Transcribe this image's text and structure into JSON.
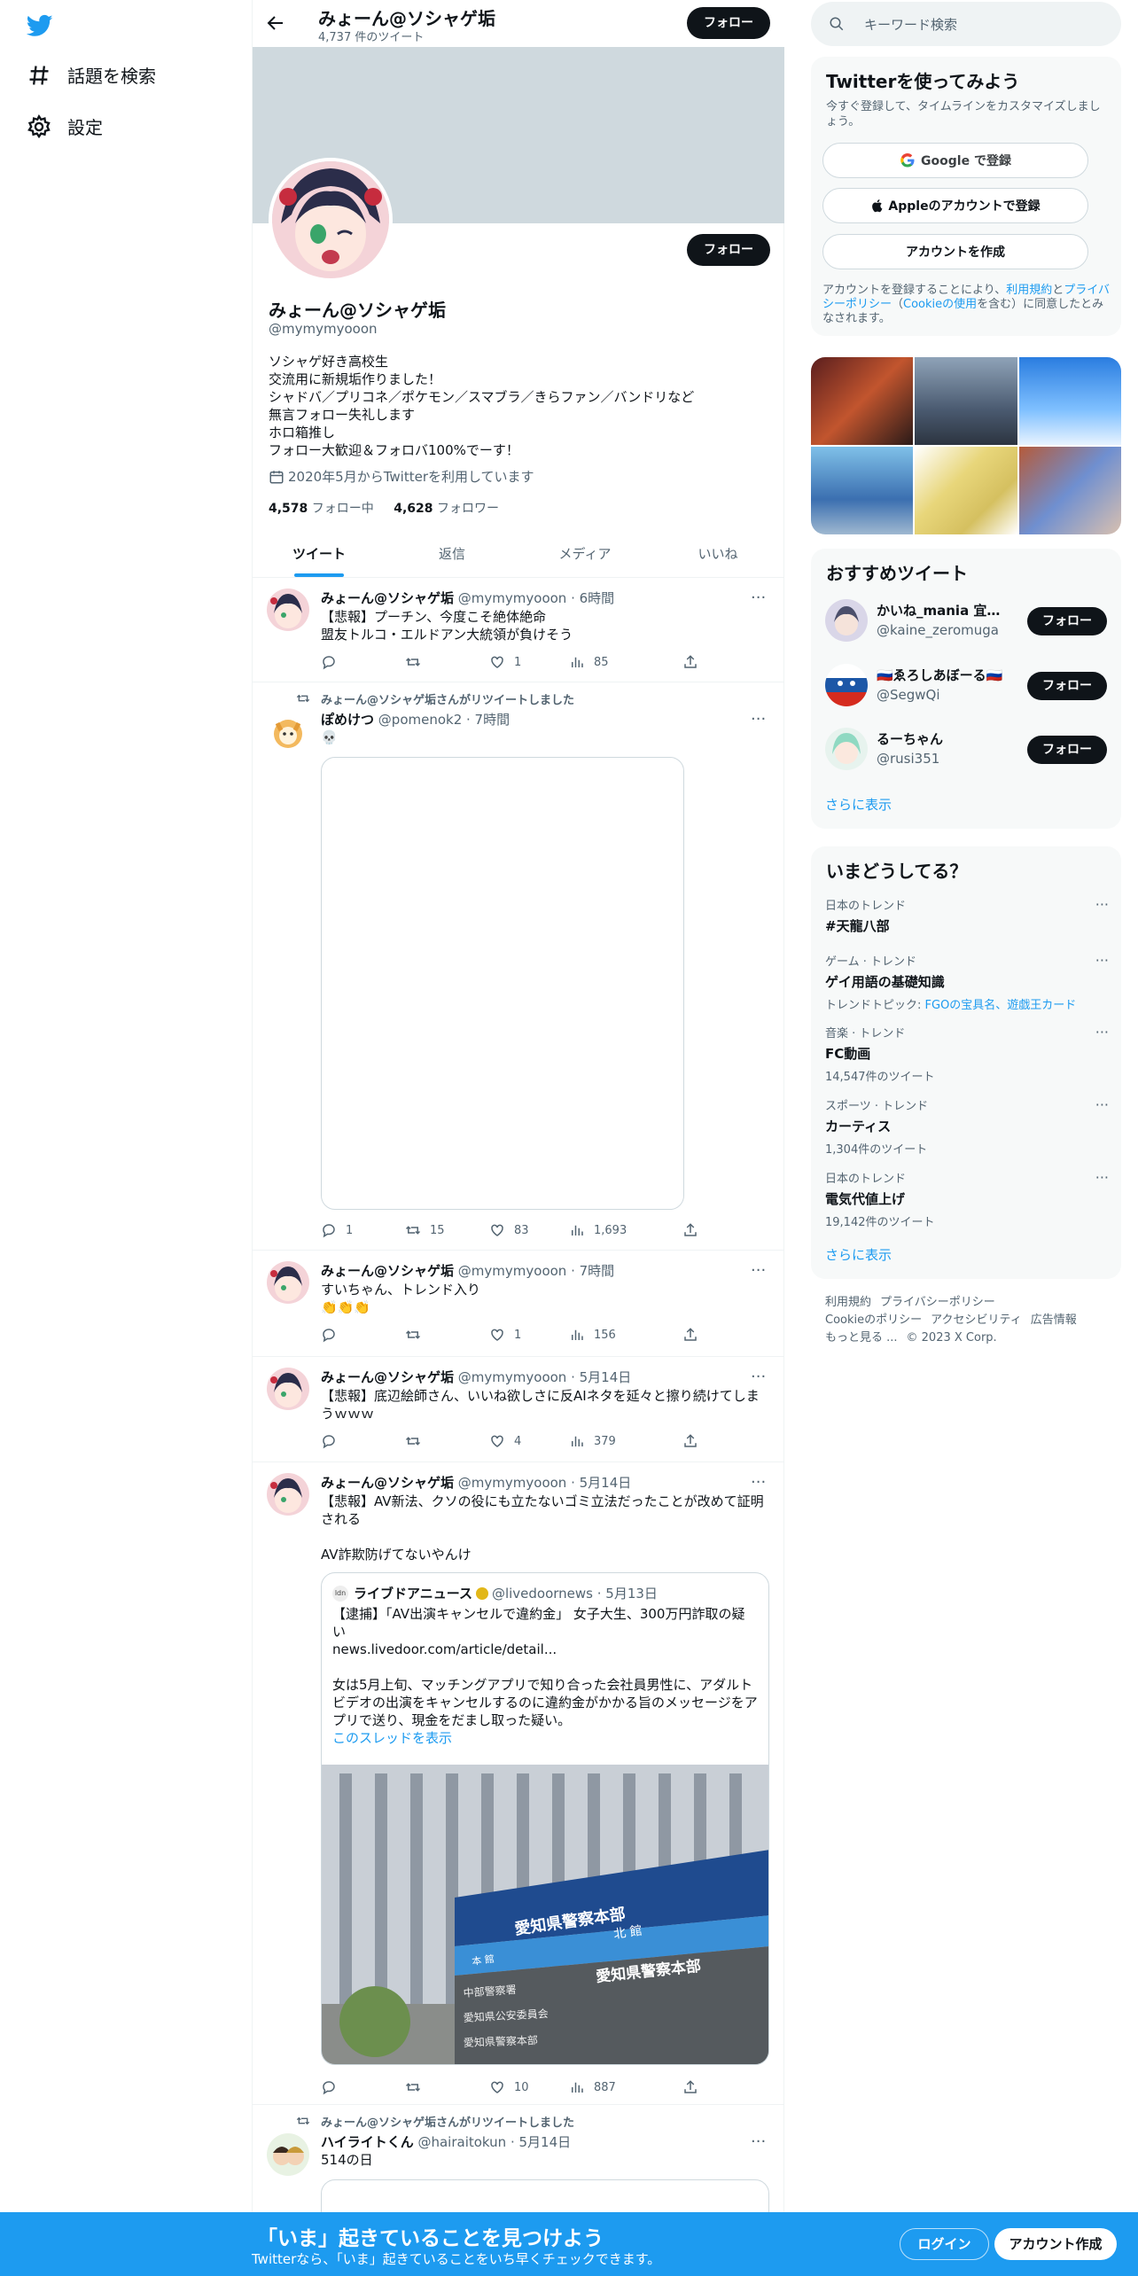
{
  "nav": {
    "logo": "twitter-bird-icon",
    "items": [
      {
        "label": "話題を検索",
        "icon": "hashtag-icon"
      },
      {
        "label": "設定",
        "icon": "gear-icon"
      }
    ]
  },
  "header": {
    "name": "みょーん@ソシャゲ垢",
    "tweet_count": "4,737 件のツイート",
    "follow_label": "フォロー"
  },
  "profile": {
    "name": "みょーん@ソシャゲ垢",
    "handle": "@mymymyooon",
    "follow_label": "フォロー",
    "bio": [
      "ソシャゲ好き高校生",
      "交流用に新規垢作りました！",
      "シャドバ／プリコネ／ポケモン／スマブラ／きらファン／バンドリなど",
      "無言フォロー失礼します",
      "ホロ箱推し",
      "フォロー大歓迎＆フォロバ100%でーす！"
    ],
    "joined": "2020年5月からTwitterを利用しています",
    "following_count": "4,578",
    "following_label": "フォロー中",
    "followers_count": "4,628",
    "followers_label": "フォロワー"
  },
  "tabs": [
    {
      "label": "ツイート",
      "active": true
    },
    {
      "label": "返信",
      "active": false
    },
    {
      "label": "メディア",
      "active": false
    },
    {
      "label": "いいね",
      "active": false
    }
  ],
  "tweets": [
    {
      "name": "みょーん@ソシャゲ垢",
      "meta": "@mymymyooon · 6時間",
      "lines": [
        "【悲報】プーチン、今度こそ絶体絶命",
        "盟友トルコ・エルドアン大統領が負けそう"
      ],
      "reply": "",
      "retweet": "",
      "like": "1",
      "views": "85"
    },
    {
      "retweet_label": "みょーん@ソシャゲ垢さんがリツイートしました",
      "name": "ぽめけつ",
      "meta": "@pomenok2 · 7時間",
      "lines": [
        "💀"
      ],
      "reply": "1",
      "retweet": "15",
      "like": "83",
      "views": "1,693"
    },
    {
      "name": "みょーん@ソシャゲ垢",
      "meta": "@mymymyooon · 7時間",
      "lines": [
        "すいちゃん、トレンド入り",
        "👏👏👏"
      ],
      "reply": "",
      "retweet": "",
      "like": "1",
      "views": "156"
    },
    {
      "name": "みょーん@ソシャゲ垢",
      "meta": "@mymymyooon · 5月14日",
      "lines": [
        "【悲報】底辺絵師さん、いいね欲しさに反AIネタを延々と擦り続けてしま",
        "うｗｗｗ"
      ],
      "reply": "",
      "retweet": "",
      "like": "4",
      "views": "379"
    },
    {
      "name": "みょーん@ソシャゲ垢",
      "meta": "@mymymyooon · 5月14日",
      "lines": [
        "【悲報】AV新法、クソの役にも立たないゴミ立法だったことが改めて証明",
        "される",
        "",
        "AV詐欺防げてないやんけ"
      ],
      "reply": "",
      "retweet": "",
      "like": "10",
      "views": "887"
    },
    {
      "retweet_label": "みょーん@ソシャゲ垢さんがリツイートしました",
      "name": "ハイライトくん",
      "meta": "@hairaitokun · 5月14日",
      "lines": [
        "514の日"
      ]
    }
  ],
  "quote": {
    "name": "ライブドアニュース",
    "meta": "@livedoornews · 5月13日",
    "lines": [
      "【逮捕】「AV出演キャンセルで違約金」 女子大生、300万円詐取の疑",
      "い",
      "news.livedoor.com/article/detail...",
      "",
      "女は5月上旬、マッチングアプリで知り合った会社員男性に、アダルト",
      "ビデオの出演をキャンセルするのに違約金がかかる旨のメッセージをア",
      "プリで送り、現金をだまし取った疑い。"
    ],
    "thread_link": "このスレッドを表示",
    "photo_signs": [
      "愛知県警察本部",
      "北 館",
      "本 館",
      "愛知県警察本部",
      "中部警察署",
      "愛知県公安委員会",
      "愛知県警察本部"
    ]
  },
  "search": {
    "placeholder": "キーワード検索"
  },
  "signup": {
    "title": "Twitterを使ってみよう",
    "subtitle": "今すぐ登録して、タイムラインをカスタマイズしましょう。",
    "google": "Google で登録",
    "apple": "Appleのアカウントで登録",
    "create": "アカウントを作成",
    "terms_prefix": "アカウントを登録することにより、",
    "terms_link1": "利用規約",
    "terms_and": "と",
    "terms_link2": "プライバシーポリシー",
    "terms_paren_open": "（",
    "terms_link3": "Cookieの使用",
    "terms_suffix": "を含む）に同意したとみなされます。"
  },
  "recommend": {
    "title": "おすすめツイート",
    "users": [
      {
        "name": "かいね_mania 宜都...",
        "handle": "@kaine_zeromuga",
        "follow": "フォロー"
      },
      {
        "name": "🇷🇺ゑろしあぼーる🇷🇺",
        "handle": "@SegwQi",
        "follow": "フォロー"
      },
      {
        "name": "るーちゃん",
        "handle": "@rusi351",
        "follow": "フォロー"
      }
    ],
    "more": "さらに表示"
  },
  "trends": {
    "title": "いまどうしてる？",
    "items": [
      {
        "category": "日本のトレンド",
        "title": "#天龍八部",
        "count": ""
      },
      {
        "category": "ゲーム · トレンド",
        "title": "ゲイ用語の基礎知識",
        "topic_prefix": "トレンドトピック: ",
        "topic_links": "FGOの宝具名、遊戯王カード"
      },
      {
        "category": "音楽 · トレンド",
        "title": "FC動画",
        "count": "14,547件のツイート"
      },
      {
        "category": "スポーツ · トレンド",
        "title": "カーティス",
        "count": "1,304件のツイート"
      },
      {
        "category": "日本のトレンド",
        "title": "電気代値上げ",
        "count": "19,142件のツイート"
      }
    ],
    "more": "さらに表示"
  },
  "footer": {
    "terms": "利用規約",
    "privacy": "プライバシーポリシー",
    "cookie": "Cookieのポリシー",
    "access": "アクセシビリティ",
    "ads": "広告情報",
    "more": "もっと見る ...",
    "copyright": "© 2023 X Corp."
  },
  "bottombar": {
    "title": "「いま」起きていることを見つけよう",
    "subtitle": "Twitterなら、「いま」起きていることをいち早くチェックできます。",
    "login": "ログイン",
    "signup": "アカウント作成"
  },
  "colors": {
    "accent": "#1d9bf0",
    "text": "#0f1419",
    "muted": "#536471",
    "banner": "#cfd9de"
  }
}
